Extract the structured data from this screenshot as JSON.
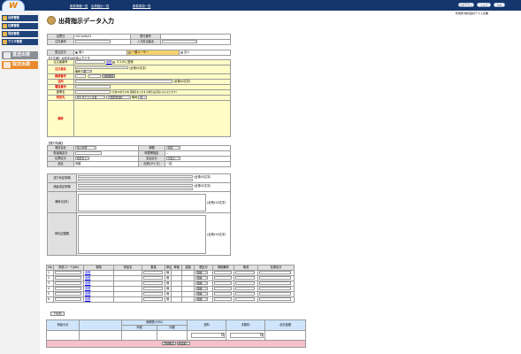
{
  "header": {
    "logo_text": "W",
    "logo_caption": "www.wellness-system.co.jp",
    "nav": [
      "新着情報一覧",
      "出荷指示一覧",
      "新着事項一覧"
    ],
    "buttons": [
      "ログアウト",
      "ヘルプ",
      "TOP"
    ],
    "user_line": "利用者 株式会社テスト企業"
  },
  "sidebar": {
    "items": [
      "出荷管理",
      "在庫管理",
      "発送管理",
      "マスタ管理"
    ],
    "banners": [
      "直送出荷",
      "取次出荷"
    ]
  },
  "page": {
    "title": "出荷指示データ入力"
  },
  "info": {
    "r1_l1": "伝票日",
    "r1_v1": "2021/06/01",
    "r1_l2": "受付番号",
    "r2_l1": "注文番号",
    "r2_l2": "入力担当者名",
    "r3_l1": "受注区分",
    "opt1": "個人",
    "opt2": "一般ユーザー",
    "opt3": "法人"
  },
  "orderer": {
    "section": "【注文者】※赤字は必須入力です",
    "l_no": "注文者番号",
    "btn_ref": "参照",
    "chk_master": "マスタに登録",
    "l_name": "注文者名",
    "name_note": "(全角20文字)",
    "l_honor": "敬称",
    "honor_val": "様",
    "l_zip": "郵便番号",
    "btn_zip": "住所検索",
    "l_addr": "住所",
    "addr_note": "(全角40文字)",
    "l_tel": "電話番号",
    "l_dept": "部署名",
    "dept_note": "(全角20文字以内 部署名を入力する場合は必須入力になります)",
    "l_ship": "荷受先",
    "ship_v1": "ＷＥＢテスト企業",
    "ship_v2": "大阪配送会社",
    "ship_hon": "様",
    "l_memo": "備考"
  },
  "shipping": {
    "section": "【発行情報】",
    "l1": "運送会社",
    "v1": "佐川急便",
    "l2": "便種",
    "v2": "指定",
    "l3": "配達指定日",
    "l4": "時間帯指定",
    "v4": "--",
    "l5": "伝票区分",
    "v5": "指定なし",
    "l6": "支払区分",
    "v6": "元払い",
    "l7": "品名",
    "v7": "衣類",
    "l8": "出荷(サイズ)",
    "v8": "ー括"
  },
  "notes": {
    "l1": "送り状記事欄",
    "l2": "納品書記事欄",
    "l3": "備考(社内)",
    "l4": "荷札記載欄",
    "note1": "(全角30文字)",
    "note2": "(全角30文字)",
    "note3": "(全角100文字)",
    "note4": "(全角100文字)"
  },
  "items": {
    "headers": [
      "No",
      "商品コード/JAN",
      "参照",
      "商品名",
      "数量",
      "単位",
      "単価",
      "金額",
      "税区分",
      "明細備考",
      "取消",
      "在庫区分"
    ],
    "rows": [
      "1",
      "2",
      "3",
      "4",
      "5",
      "6"
    ],
    "ref": "参照",
    "unit": "個",
    "tax": "税抜",
    "add_btn": "行追加"
  },
  "totals": {
    "h1": "商品小計",
    "h2": "送料",
    "h3": "手数料",
    "h4": "消費税(10%)",
    "h5": "外税",
    "h6": "内税",
    "h7": "合計金額",
    "v_ship": "0",
    "v_fee": "0"
  },
  "actions": {
    "confirm": "登録確認",
    "return": "前画面へ"
  },
  "colors": {
    "header": "#14366c",
    "sidebar": "#20437a",
    "yellow": "#fffcc5",
    "blue": "#cfe5fb",
    "pink": "#f6c0c8"
  }
}
